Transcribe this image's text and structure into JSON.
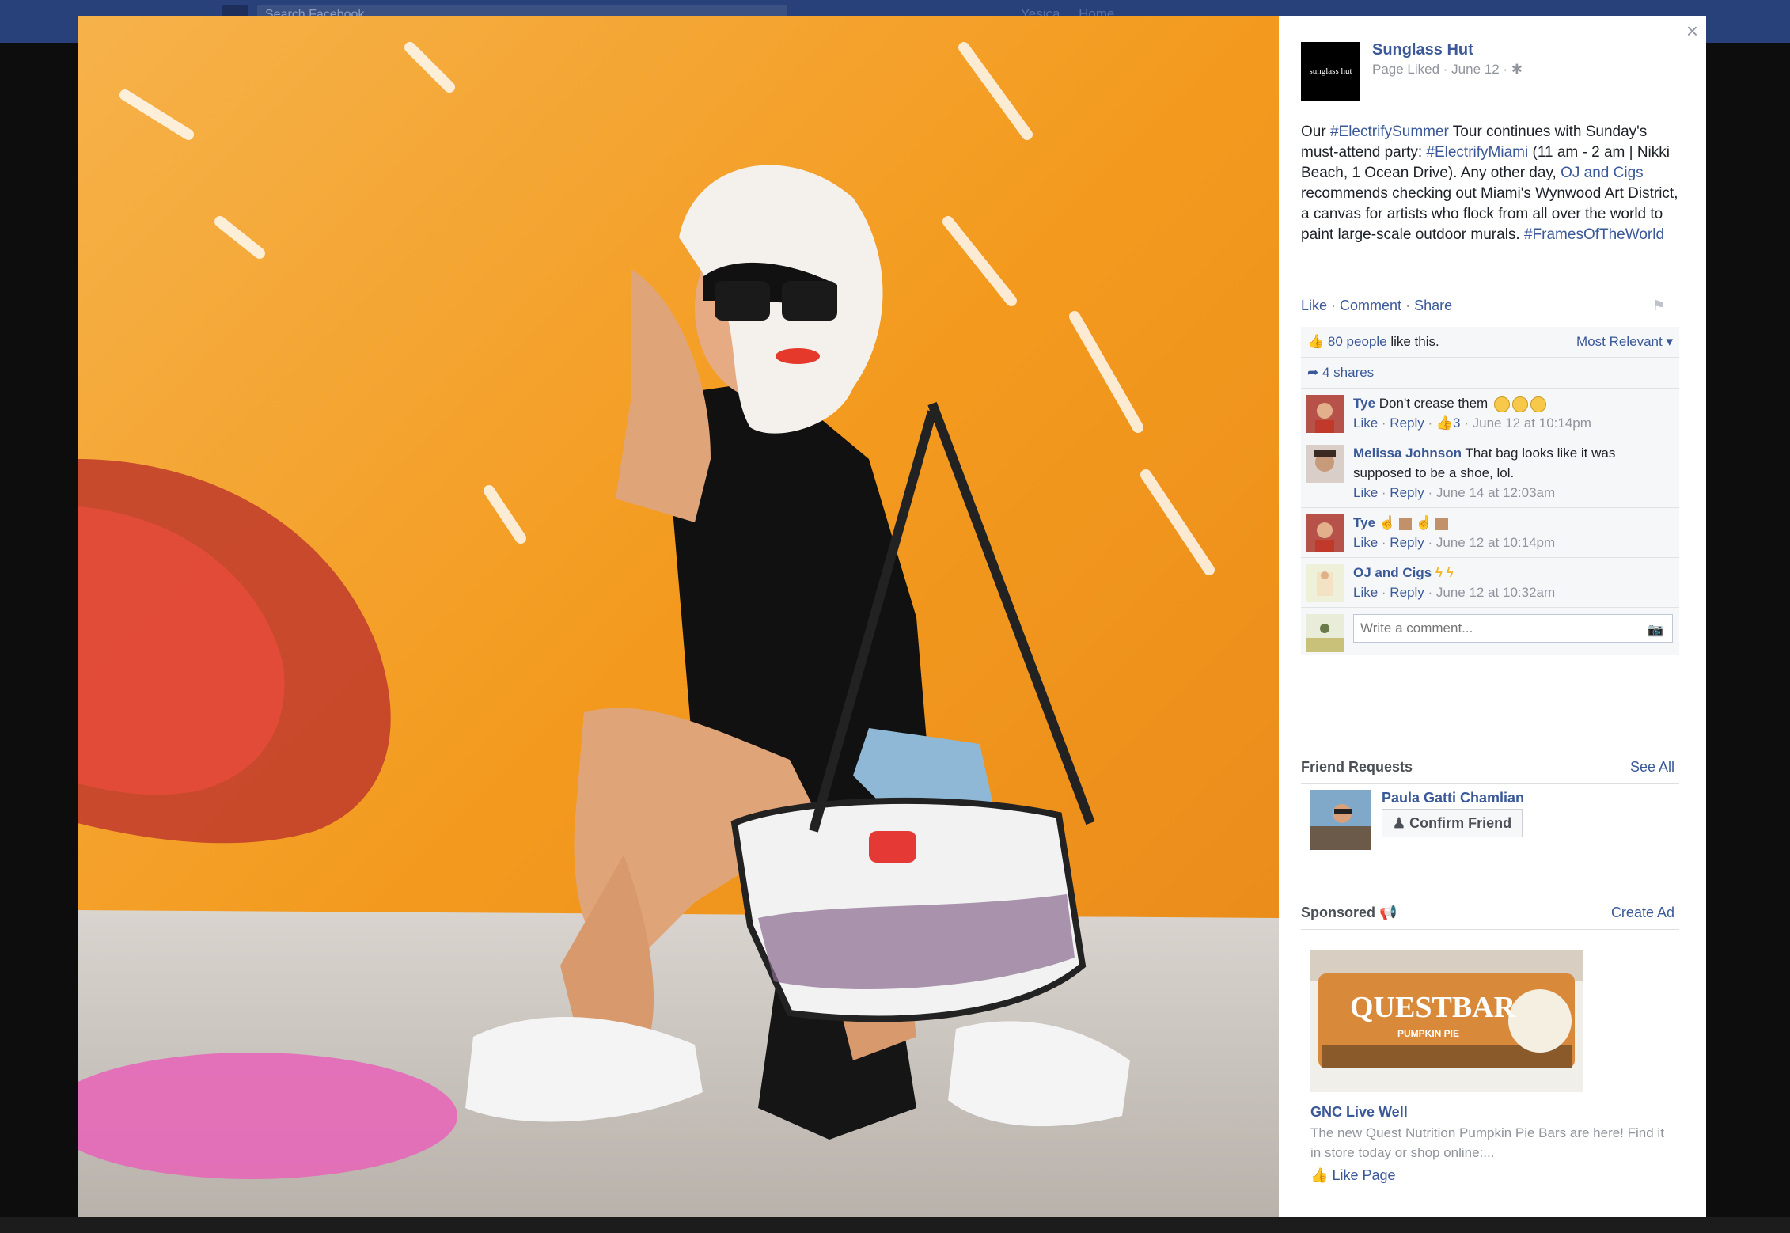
{
  "topbar": {
    "search_placeholder": "Search Facebook",
    "nav_user": "Yesica",
    "nav_home": "Home"
  },
  "close_symbol": "×",
  "page": {
    "logo_text": "sunglass hut",
    "name": "Sunglass Hut",
    "meta": "Page Liked · June 12 ·"
  },
  "post": {
    "t1": "Our ",
    "h1": "#ElectrifySummer",
    "t2": " Tour continues with Sunday's must-attend party: ",
    "h2": "#ElectrifyMiami",
    "t3": " (11 am - 2 am | Nikki Beach, 1 Ocean Drive). Any other day, ",
    "h3": "OJ and Cigs",
    "t4": " recommends checking out Miami's Wynwood Art District, a canvas for artists who flock from all over the world to paint large-scale outdoor murals. ",
    "h4": "#FramesOfTheWorld"
  },
  "actions": {
    "like": "Like",
    "comment": "Comment",
    "share": "Share",
    "sep": " · "
  },
  "ufi": {
    "likes_link": "80 people",
    "likes_text": " like this.",
    "sort": "Most Relevant",
    "shares": "4 shares"
  },
  "comments": [
    {
      "name": "Tye",
      "text": "Don't crease them",
      "like": "Like",
      "reply": "Reply",
      "likes": "3",
      "time": "June 12 at 10:14pm"
    },
    {
      "name": "Melissa Johnson",
      "text": "That bag looks like it was supposed to be a shoe, lol.",
      "like": "Like",
      "reply": "Reply",
      "time": "June 14 at 12:03am"
    },
    {
      "name": "Tye",
      "text": "",
      "like": "Like",
      "reply": "Reply",
      "time": "June 12 at 10:14pm"
    },
    {
      "name": "OJ and Cigs",
      "text": "",
      "like": "Like",
      "reply": "Reply",
      "time": "June 12 at 10:32am"
    }
  ],
  "write_comment_placeholder": "Write a comment...",
  "friend_requests": {
    "title": "Friend Requests",
    "see_all": "See All",
    "name": "Paula Gatti Chamlian",
    "confirm": "Confirm Friend"
  },
  "sponsored": {
    "title": "Sponsored",
    "create_ad": "Create Ad",
    "ad_image_text": "QUESTBAR",
    "ad_image_sub": "PUMPKIN PIE",
    "ad_title": "GNC Live Well",
    "ad_body": "The new Quest Nutrition Pumpkin Pie Bars are here! Find it in store today or shop online:...",
    "like_page": "Like Page"
  },
  "colors": {
    "link": "#3b5998",
    "wall": "#f39a1e",
    "topbar": "#29417a"
  }
}
